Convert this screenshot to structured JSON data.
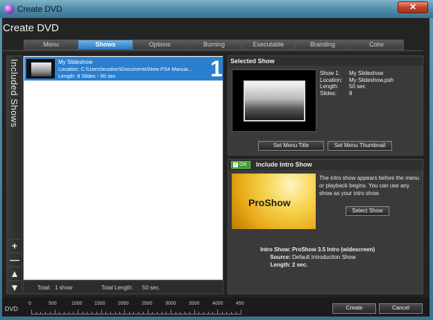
{
  "window": {
    "title": "Create DVD",
    "close_glyph": "✕"
  },
  "dialog": {
    "title": "Create DVD"
  },
  "tabs": [
    {
      "label": "Menu"
    },
    {
      "label": "Shows"
    },
    {
      "label": "Options"
    },
    {
      "label": "Burning"
    },
    {
      "label": "Executable"
    },
    {
      "label": "Branding"
    },
    {
      "label": "Color"
    }
  ],
  "active_tab": "Shows",
  "left_bar": {
    "label": "Included Shows",
    "buttons": [
      "+",
      "—",
      "▲",
      "▼"
    ]
  },
  "show_list": {
    "items": [
      {
        "name": "My Slideshow",
        "location": "Location: C:\\Users\\eustion\\Documents\\New PS4 Manua...",
        "length": "Length: 8 Slides - 50 sec",
        "number": "1"
      }
    ],
    "footer": {
      "total_label": "Total:",
      "total_value": "1 show",
      "length_label": "Total Length:",
      "length_value": "50 sec."
    }
  },
  "selected_show": {
    "header": "Selected Show",
    "keys": [
      "Show 1:",
      "Location:",
      "Length:",
      "Slides:"
    ],
    "values": [
      "My Slideshow",
      "My Slideshow.psh",
      "50 sec",
      "8"
    ],
    "set_title_button": "Set Menu Title",
    "set_thumb_button": "Set Menu Thumbnail"
  },
  "intro": {
    "toggle_label": "ON",
    "header": "Include Intro Show",
    "thumb_logo": "ProShow",
    "description": "The intro show appears before the menu or playback begins. You can use any show as your intro show.",
    "select_button": "Select Show",
    "info_keys": [
      "Intro Show:",
      "Source:",
      "Length:"
    ],
    "info_values": [
      "ProShow 3.5 Intro (widescreen)",
      "Default Introduction Show",
      "2 sec."
    ]
  },
  "bottom": {
    "dvd_label": "DVD",
    "ruler_labels": [
      "0",
      "500",
      "1000",
      "1500",
      "2000",
      "2500",
      "3000",
      "3500",
      "4000",
      "450"
    ],
    "create_button": "Create",
    "cancel_button": "Cancel"
  }
}
